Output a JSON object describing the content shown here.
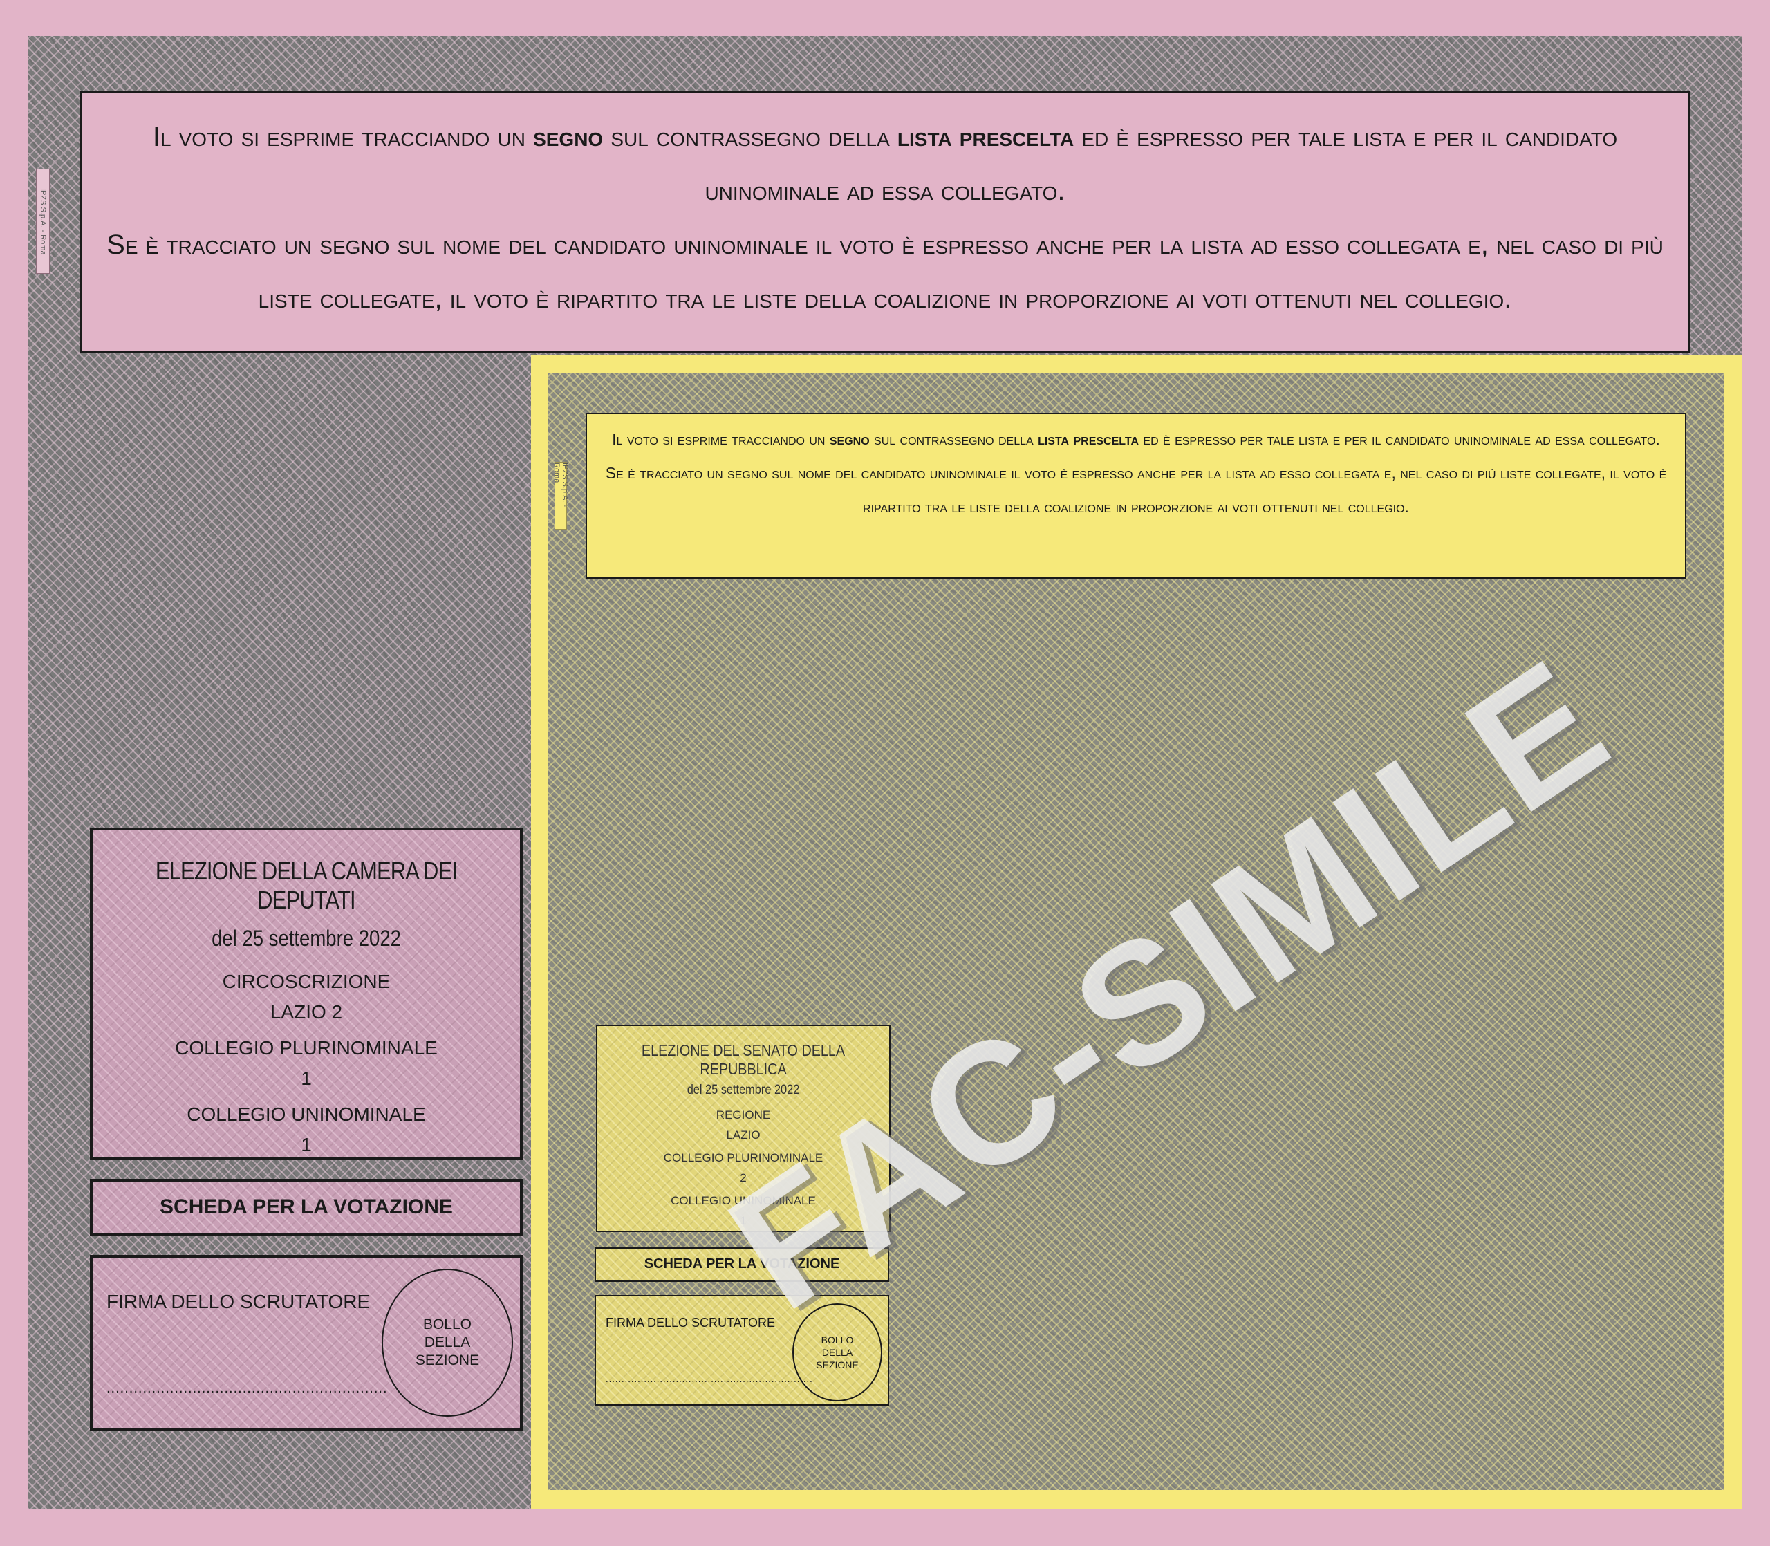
{
  "camera": {
    "instructions": {
      "p1_a": "Il voto si esprime tracciando un ",
      "p1_b": "segno",
      "p1_c": " sul contrassegno della ",
      "p1_d": "lista prescelta",
      "p1_e": " ed è espresso per tale lista e per il candidato uninominale ad essa collegato.",
      "p2": "Se è tracciato un segno sul nome del candidato uninominale il voto è espresso anche per la lista ad esso collegata e, nel caso di più liste collegate, il voto è ripartito tra le liste della coalizione in proporzione ai voti ottenuti nel collegio."
    },
    "printer_stamp": "IPZS S.p.A. - Roma",
    "header": {
      "title": "ELEZIONE DELLA CAMERA DEI DEPUTATI",
      "date": "del 25 settembre 2022",
      "l1": "CIRCOSCRIZIONE",
      "l2": "LAZIO 2",
      "l3": "COLLEGIO PLURINOMINALE",
      "l4": "1",
      "l5": "COLLEGIO UNINOMINALE",
      "l6": "1"
    },
    "scheda": "SCHEDA PER LA VOTAZIONE",
    "firma": "FIRMA DELLO SCRUTATORE",
    "dots": "..............................................................",
    "bollo": [
      "BOLLO",
      "DELLA",
      "SEZIONE"
    ]
  },
  "senato": {
    "instructions": {
      "p1_a": "Il voto si esprime tracciando un ",
      "p1_b": "segno",
      "p1_c": " sul contrassegno della ",
      "p1_d": "lista prescelta",
      "p1_e": " ed è espresso per tale lista e per il candidato uninominale ad essa collegato.",
      "p2": "Se è tracciato un segno sul nome del candidato uninominale il voto è espresso anche per la lista ad esso collegata e, nel caso di più liste collegate, il voto è ripartito tra le liste della coalizione in proporzione ai voti ottenuti nel collegio."
    },
    "printer_stamp": "IPZS S.p.A. - Roma",
    "header": {
      "title": "ELEZIONE DEL SENATO DELLA REPUBBLICA",
      "date": "del 25 settembre 2022",
      "l1": "REGIONE",
      "l2": "LAZIO",
      "l3": "COLLEGIO PLURINOMINALE",
      "l4": "2",
      "l5": "COLLEGIO UNINOMINALE",
      "l6": "1"
    },
    "scheda": "SCHEDA PER LA VOTAZIONE",
    "firma": "FIRMA DELLO SCRUTATORE",
    "dots": ".................................................................",
    "bollo": [
      "BOLLO",
      "DELLA",
      "SEZIONE"
    ]
  },
  "watermark": "FAC-SIMILE",
  "colors": {
    "camera_pink": "#e2b4c8",
    "senato_yellow": "#f6e97a",
    "pattern_grey": "#7a7a7a"
  }
}
